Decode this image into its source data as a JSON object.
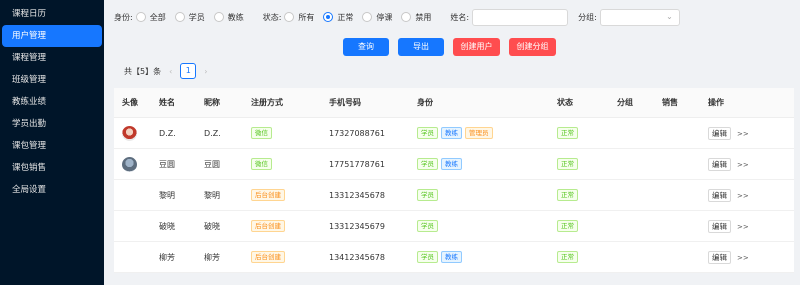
{
  "sidebar": {
    "items": [
      {
        "label": "课程日历"
      },
      {
        "label": "用户管理"
      },
      {
        "label": "课程管理"
      },
      {
        "label": "班级管理"
      },
      {
        "label": "教练业绩"
      },
      {
        "label": "学员出勤"
      },
      {
        "label": "课包管理"
      },
      {
        "label": "课包销售"
      },
      {
        "label": "全局设置"
      }
    ],
    "active_index": 1
  },
  "filters": {
    "identity_label": "身份:",
    "identity_options": [
      "全部",
      "学员",
      "教练"
    ],
    "status_label": "状态:",
    "status_options": [
      "所有",
      "正常",
      "停课",
      "禁用"
    ],
    "status_selected": "正常",
    "name_label": "姓名:",
    "name_value": "",
    "group_label": "分组:",
    "group_value": ""
  },
  "buttons": {
    "query": "查询",
    "export": "导出",
    "create_user": "创建用户",
    "create_group": "创建分组"
  },
  "colors": {
    "primary": "#1677ff",
    "danger": "#ff4d4f",
    "sidebar_bg": "#001529"
  },
  "pagination": {
    "total_text": "共【5】条",
    "prev": "‹",
    "next": "›",
    "current": "1"
  },
  "table": {
    "headers": [
      "头像",
      "姓名",
      "昵称",
      "注册方式",
      "手机号码",
      "身份",
      "状态",
      "分组",
      "销售",
      "操作"
    ],
    "edit_label": "编辑",
    "more_label": ">>",
    "rows": [
      {
        "avatar": "a1",
        "name": "D.Z.",
        "nick": "D.Z.",
        "reg": "微信",
        "reg_color": "green",
        "phone": "17327088761",
        "roles": [
          {
            "t": "学员",
            "c": "green"
          },
          {
            "t": "教练",
            "c": "blue"
          },
          {
            "t": "管理员",
            "c": "orange"
          }
        ],
        "status": "正常"
      },
      {
        "avatar": "a2",
        "name": "豆圆",
        "nick": "豆圆",
        "reg": "微信",
        "reg_color": "green",
        "phone": "17751778761",
        "roles": [
          {
            "t": "学员",
            "c": "green"
          },
          {
            "t": "教练",
            "c": "blue"
          }
        ],
        "status": "正常"
      },
      {
        "avatar": "",
        "name": "黎明",
        "nick": "黎明",
        "reg": "后台创建",
        "reg_color": "orange",
        "phone": "13312345678",
        "roles": [
          {
            "t": "学员",
            "c": "green"
          }
        ],
        "status": "正常"
      },
      {
        "avatar": "",
        "name": "破晓",
        "nick": "破晓",
        "reg": "后台创建",
        "reg_color": "orange",
        "phone": "13312345679",
        "roles": [
          {
            "t": "学员",
            "c": "green"
          }
        ],
        "status": "正常"
      },
      {
        "avatar": "",
        "name": "柳芳",
        "nick": "柳芳",
        "reg": "后台创建",
        "reg_color": "orange",
        "phone": "13412345678",
        "roles": [
          {
            "t": "学员",
            "c": "green"
          },
          {
            "t": "教练",
            "c": "blue"
          }
        ],
        "status": "正常"
      }
    ]
  }
}
